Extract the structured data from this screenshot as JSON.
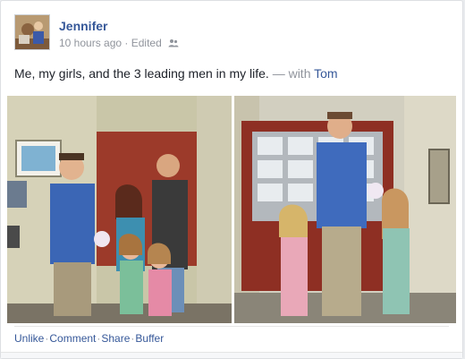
{
  "post": {
    "author": "Jennifer",
    "timestamp": "10 hours ago",
    "edited": "Edited",
    "audience_icon": "friends-icon",
    "text": "Me, my girls, and the 3 leading men in my life.",
    "with_prefix": "— with",
    "tagged": "Tom"
  },
  "actions": {
    "unlike": "Unlike",
    "comment": "Comment",
    "share": "Share",
    "buffer": "Buffer",
    "separator": "·"
  },
  "colors": {
    "link": "#365899",
    "meta": "#90949c",
    "card_border": "#dddfe2"
  }
}
